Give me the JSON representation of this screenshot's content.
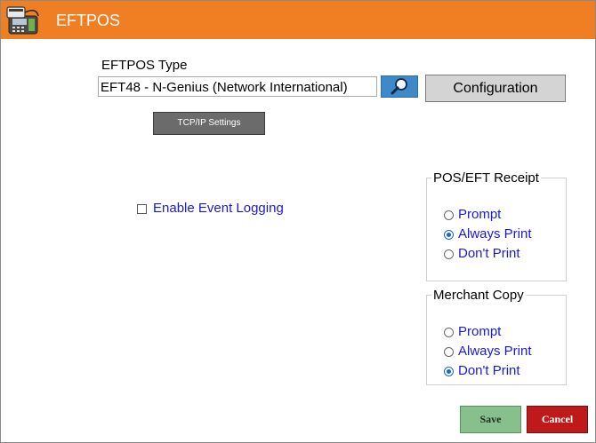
{
  "window": {
    "title": "EFTPOS",
    "icon": "payment-terminal-icon"
  },
  "eftpos_type": {
    "label": "EFTPOS Type",
    "value": "EFT48 - N-Genius (Network International)",
    "search_icon": "magnifier-icon",
    "configuration_label": "Configuration",
    "tcp_label": "TCP/IP Settings"
  },
  "logging": {
    "label": "Enable Event Logging",
    "checked": false
  },
  "pos_receipt": {
    "legend": "POS/EFT Receipt",
    "options": [
      {
        "label": "Prompt",
        "selected": false
      },
      {
        "label": "Always Print",
        "selected": true
      },
      {
        "label": "Don't Print",
        "selected": false
      }
    ]
  },
  "merchant_copy": {
    "legend": "Merchant Copy",
    "options": [
      {
        "label": "Prompt",
        "selected": false
      },
      {
        "label": "Always Print",
        "selected": false
      },
      {
        "label": "Don't Print",
        "selected": true
      }
    ]
  },
  "buttons": {
    "save": "Save",
    "cancel": "Cancel"
  },
  "colors": {
    "titlebar": "#f07f24",
    "link_text": "#1a1ad6",
    "save": "#87c08d",
    "cancel": "#bf1a1a"
  }
}
